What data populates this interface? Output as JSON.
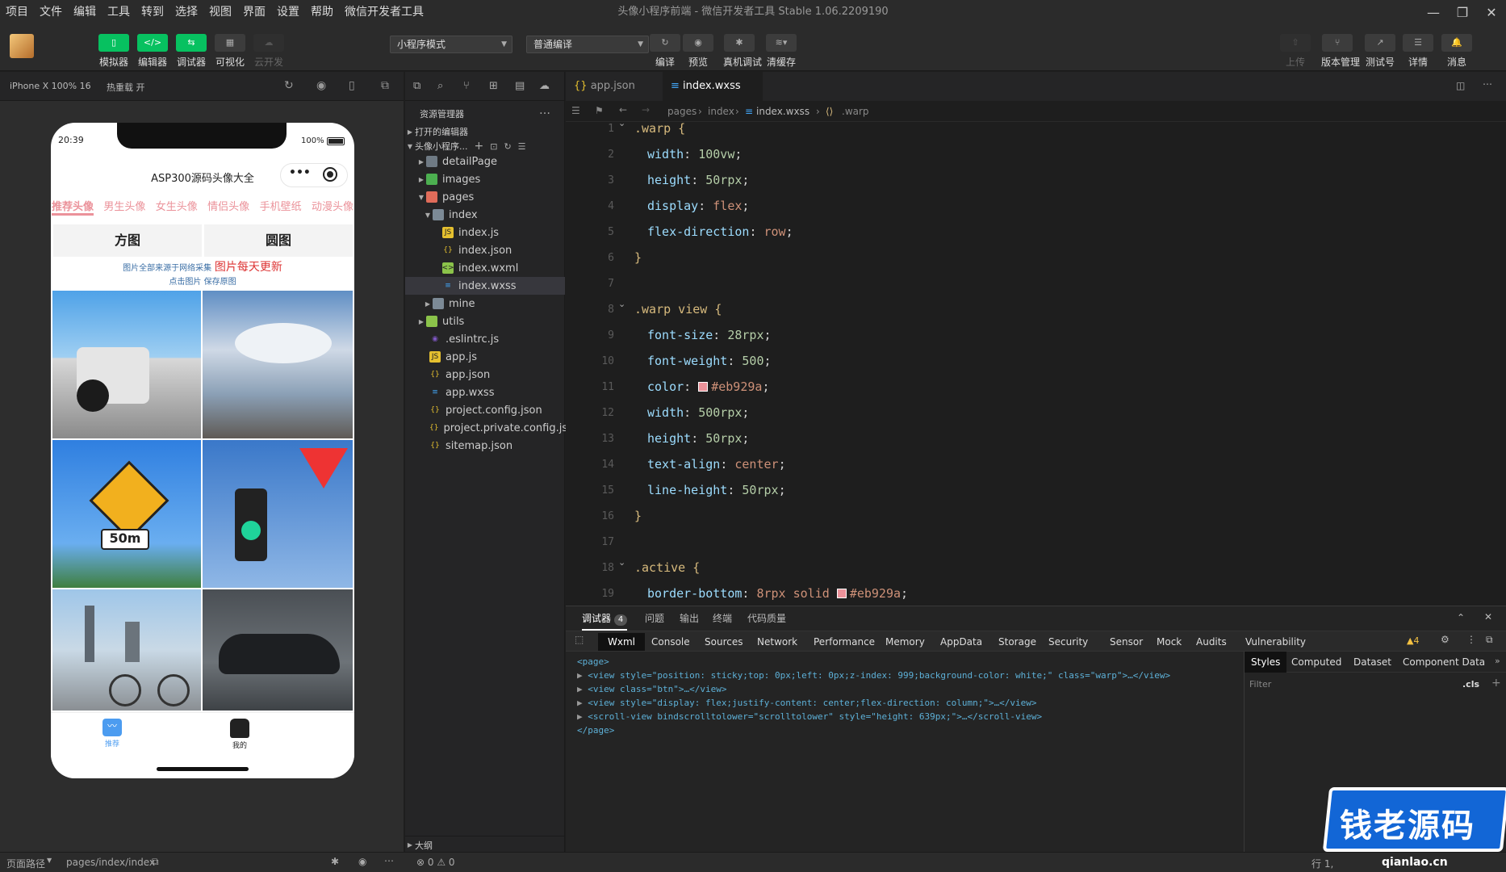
{
  "menubar": {
    "items": [
      "项目",
      "文件",
      "编辑",
      "工具",
      "转到",
      "选择",
      "视图",
      "界面",
      "设置",
      "帮助",
      "微信开发者工具"
    ]
  },
  "window": {
    "title": "头像小程序前端 - 微信开发者工具 Stable 1.06.2209190"
  },
  "toolbar": {
    "simulator": "模拟器",
    "editor": "编辑器",
    "debugger": "调试器",
    "visual": "可视化",
    "cloud": "云开发",
    "mode": "小程序模式",
    "compile_mode": "普通编译",
    "compile": "编译",
    "preview": "预览",
    "real_debug": "真机调试",
    "clear_cache": "清缓存",
    "upload": "上传",
    "version": "版本管理",
    "test_account": "测试号",
    "details": "详情",
    "messages": "消息",
    "accent": "#07c160"
  },
  "simbar": {
    "device": "iPhone X 100% 16",
    "hot_reload": "热重载 开"
  },
  "phone": {
    "time": "20:39",
    "battery": "100%",
    "nav_title": "ASP300源码头像大全",
    "categories": [
      "推荐头像",
      "男生头像",
      "女生头像",
      "情侣头像",
      "手机壁纸",
      "动漫头像"
    ],
    "accent": "#eb929a",
    "tab_square": "方图",
    "tab_round": "圆图",
    "notice_small": "图片全部来源于网络采集",
    "notice_big": "图片每天更新",
    "notice_sub": "点击图片 保存原图",
    "tabbar_recommend": "推荐",
    "tabbar_mine": "我的"
  },
  "explorer": {
    "title": "资源管理器",
    "open_editors": "打开的编辑器",
    "project": "头像小程序...",
    "outline": "大纲",
    "items": [
      {
        "name": "detailPage",
        "type": "folder"
      },
      {
        "name": "images",
        "type": "folder"
      },
      {
        "name": "pages",
        "type": "folder"
      },
      {
        "name": "index",
        "type": "folder"
      },
      {
        "name": "index.js",
        "type": "js"
      },
      {
        "name": "index.json",
        "type": "json"
      },
      {
        "name": "index.wxml",
        "type": "wxml"
      },
      {
        "name": "index.wxss",
        "type": "wxss"
      },
      {
        "name": "mine",
        "type": "folder"
      },
      {
        "name": "utils",
        "type": "folder"
      },
      {
        "name": ".eslintrc.js",
        "type": "eslint"
      },
      {
        "name": "app.js",
        "type": "js"
      },
      {
        "name": "app.json",
        "type": "json"
      },
      {
        "name": "app.wxss",
        "type": "wxss"
      },
      {
        "name": "project.config.json",
        "type": "json"
      },
      {
        "name": "project.private.config.js...",
        "type": "json"
      },
      {
        "name": "sitemap.json",
        "type": "json"
      }
    ]
  },
  "editor": {
    "tab1": "app.json",
    "tab2": "index.wxss",
    "crumb1": "pages",
    "crumb2": "index",
    "crumb3": "index.wxss",
    "crumb4": ".warp",
    "line_numbers": [
      "1",
      "2",
      "3",
      "4",
      "5",
      "6",
      "7",
      "8",
      "9",
      "10",
      "11",
      "12",
      "13",
      "14",
      "15",
      "16",
      "17",
      "18",
      "19"
    ],
    "code": {
      "l1": ".warp {",
      "l2p": "width",
      "l2v": "100vw",
      "l3p": "height",
      "l3v": "50rpx",
      "l4p": "display",
      "l4v": "flex",
      "l5p": "flex-direction",
      "l5v": "row",
      "l6": "}",
      "l8": ".warp view {",
      "l9p": "font-size",
      "l9v": "28rpx",
      "l10p": "font-weight",
      "l10v": "500",
      "l11p": "color",
      "l11v": "#eb929a",
      "l12p": "width",
      "l12v": "500rpx",
      "l13p": "height",
      "l13v": "50rpx",
      "l14p": "text-align",
      "l14v": "center",
      "l15p": "line-height",
      "l15v": "50rpx",
      "l16": "}",
      "l18": ".active {",
      "l19p": "border-bottom",
      "l19v": "8rpx solid",
      "l19c": "#eb929a"
    }
  },
  "devtools": {
    "tab_debugger": "调试器",
    "badge": "4",
    "tab_issues": "问题",
    "tab_output": "输出",
    "tab_terminal": "终端",
    "tab_quality": "代码质量",
    "panels": [
      "Wxml",
      "Console",
      "Sources",
      "Network",
      "Performance",
      "Memory",
      "AppData",
      "Storage",
      "Security",
      "Sensor",
      "Mock",
      "Audits",
      "Vulnerability"
    ],
    "warn": "▲4",
    "right_tabs": [
      "Styles",
      "Computed",
      "Dataset",
      "Component Data"
    ],
    "filter": "Filter",
    "cls": ".cls",
    "xml": [
      "<page>",
      "<view style=\"position: sticky;top: 0px;left: 0px;z-index: 999;background-color: white;\" class=\"warp\">…</view>",
      "<view class=\"btn\">…</view>",
      "<view style=\"display: flex;justify-content: center;flex-direction: column;\">…</view>",
      "<scroll-view bindscrolltolower=\"scrolltolower\" style=\"height: 639px;\">…</scroll-view>",
      "</page>"
    ]
  },
  "status": {
    "path_label": "页面路径",
    "path": "pages/index/index",
    "errors": "⊗ 0 ⚠ 0",
    "pos": "行 1,"
  },
  "watermark": {
    "text": "钱老源码",
    "url": "qianlao.cn"
  }
}
